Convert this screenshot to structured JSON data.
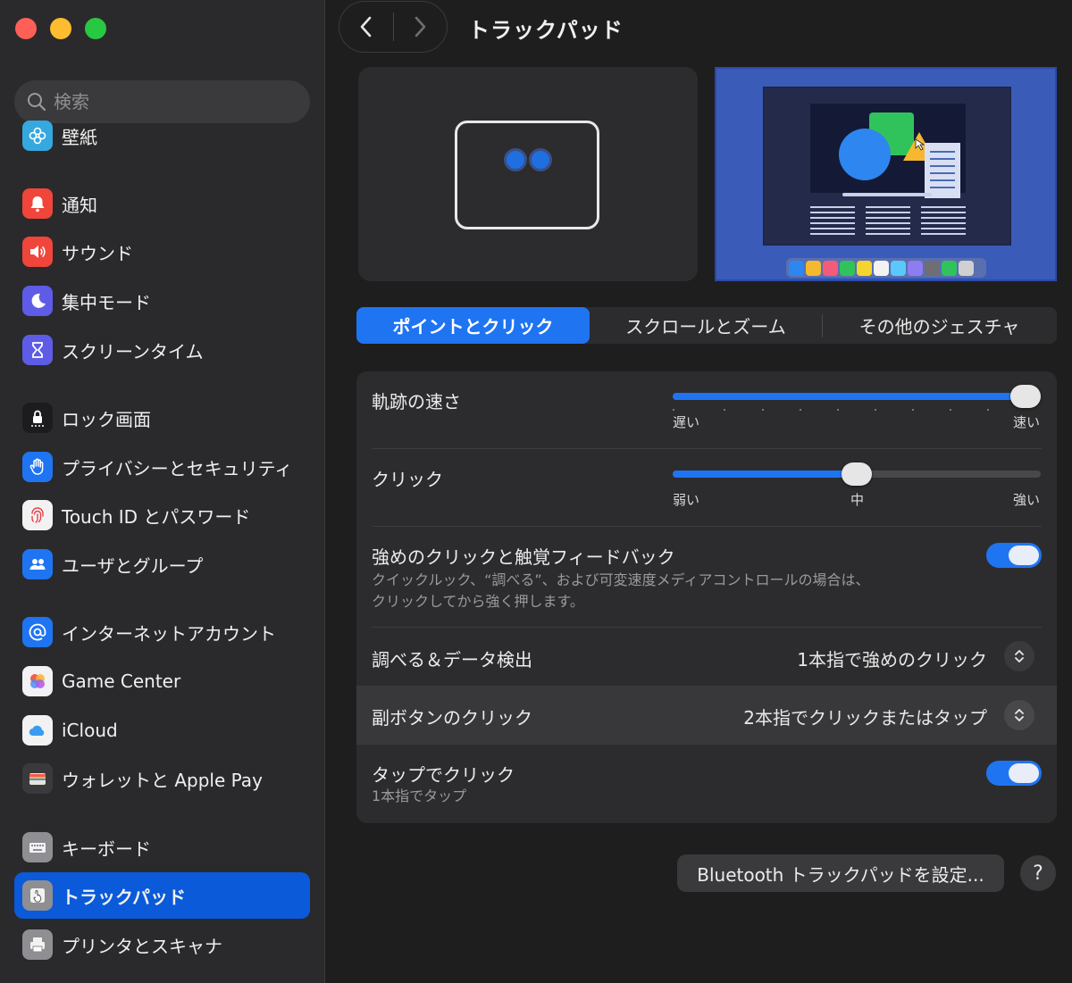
{
  "window": {
    "title": "トラックパッド"
  },
  "search": {
    "placeholder": "検索"
  },
  "sidebar": {
    "items": [
      {
        "label": "壁紙",
        "icon": "wallpaper-icon",
        "color": "#35a8e0"
      },
      {
        "label": "通知",
        "icon": "bell-icon",
        "color": "#f0453a"
      },
      {
        "label": "サウンド",
        "icon": "speaker-icon",
        "color": "#f0453a"
      },
      {
        "label": "集中モード",
        "icon": "moon-icon",
        "color": "#5e5ce6"
      },
      {
        "label": "スクリーンタイム",
        "icon": "hourglass-icon",
        "color": "#5e5ce6"
      },
      {
        "label": "ロック画面",
        "icon": "lock-icon",
        "color": "#1c1c1e"
      },
      {
        "label": "プライバシーとセキュリティ",
        "icon": "hand-icon",
        "color": "#1f74f2"
      },
      {
        "label": "Touch ID とパスワード",
        "icon": "fingerprint-icon",
        "color": "#f2f2f2"
      },
      {
        "label": "ユーザとグループ",
        "icon": "users-icon",
        "color": "#1f74f2"
      },
      {
        "label": "インターネットアカウント",
        "icon": "at-icon",
        "color": "#1f74f2"
      },
      {
        "label": "Game Center",
        "icon": "game-center-icon",
        "color": "#f2f2f2"
      },
      {
        "label": "iCloud",
        "icon": "cloud-icon",
        "color": "#f2f2f2"
      },
      {
        "label": "ウォレットと Apple Pay",
        "icon": "wallet-icon",
        "color": "#3a3a3c"
      },
      {
        "label": "キーボード",
        "icon": "keyboard-icon",
        "color": "#8e8e93"
      },
      {
        "label": "トラックパッド",
        "icon": "trackpad-icon",
        "color": "#8e8e93"
      },
      {
        "label": "プリンタとスキャナ",
        "icon": "printer-icon",
        "color": "#8e8e93"
      }
    ],
    "selected": "トラックパッド"
  },
  "tabs": [
    {
      "label": "ポイントとクリック",
      "active": true
    },
    {
      "label": "スクロールとズーム",
      "active": false
    },
    {
      "label": "その他のジェスチャ",
      "active": false
    }
  ],
  "settings": {
    "tracking_speed": {
      "label": "軌跡の速さ",
      "min_label": "遅い",
      "max_label": "速い",
      "value": 1.0
    },
    "click": {
      "label": "クリック",
      "min_label": "弱い",
      "mid_label": "中",
      "max_label": "強い",
      "value": 0.5
    },
    "force_click": {
      "label": "強めのクリックと触覚フィードバック",
      "description_line1": "クイックルック、“調べる”、および可変速度メディアコントロールの場合は、",
      "description_line2": "クリックしてから強く押します。",
      "enabled": true
    },
    "lookup": {
      "label": "調べる＆データ検出",
      "value": "1本指で強めのクリック"
    },
    "secondary_click": {
      "label": "副ボタンのクリック",
      "value": "2本指でクリックまたはタップ"
    },
    "tap_to_click": {
      "label": "タップでクリック",
      "description": "1本指でタップ",
      "enabled": true
    }
  },
  "footer": {
    "bluetooth_button": "Bluetooth トラックパッドを設定...",
    "help_button": "?"
  },
  "colors": {
    "accent": "#1f74f2",
    "sidebar_selected": "#0a5ad9"
  }
}
